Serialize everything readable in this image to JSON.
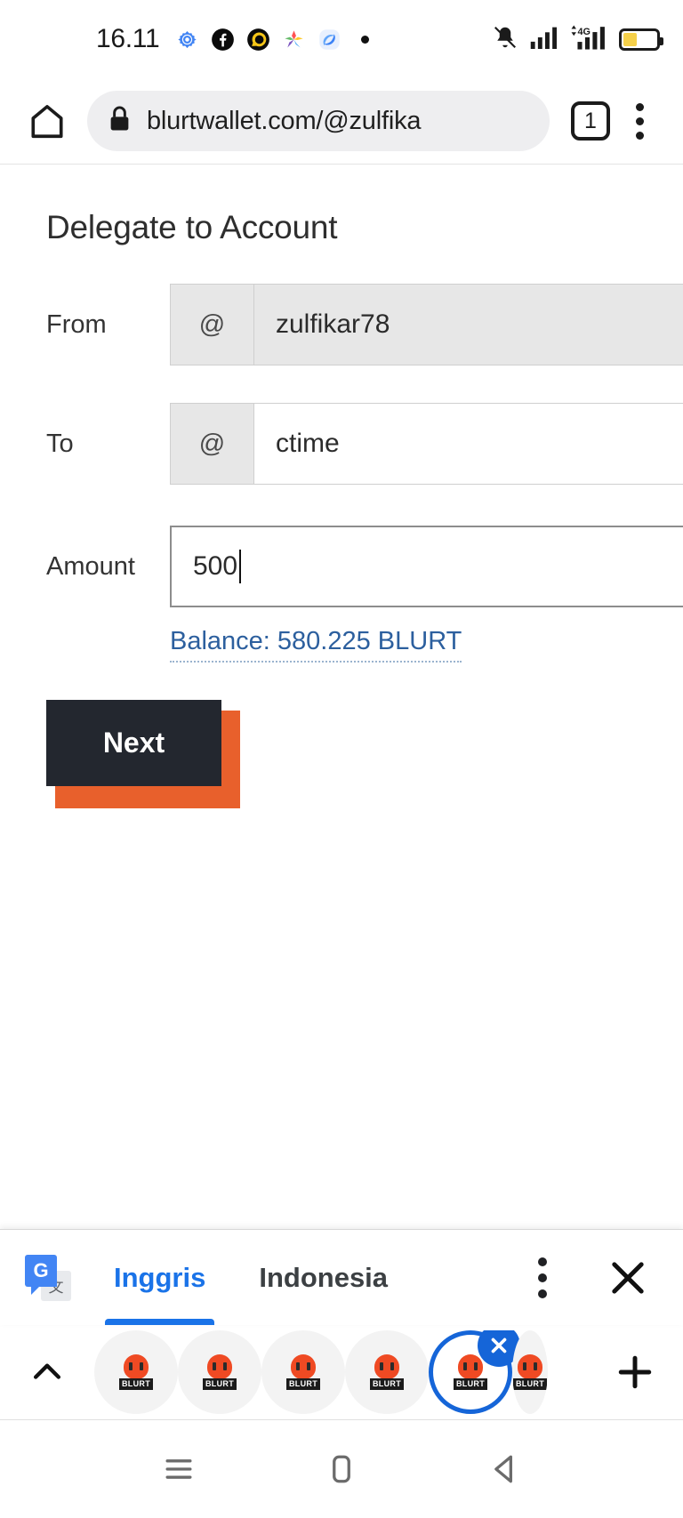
{
  "status_bar": {
    "clock": "16.11",
    "left_icons": [
      "settings-gear-icon",
      "facebook-icon",
      "whatsapp-business-icon",
      "colorful-star-icon",
      "opera-icon",
      "dot-icon"
    ],
    "right_icons": [
      "vibrate-mode-icon",
      "signal-bars-icon",
      "4g-signal-icon",
      "battery-icon"
    ],
    "network_label": "4G"
  },
  "browser": {
    "home_icon": "home-icon",
    "lock_icon": "lock-icon",
    "url": "blurtwallet.com/@zulfika",
    "tab_count": "1",
    "menu_icon": "kebab-menu-icon"
  },
  "page": {
    "title": "Delegate to Account",
    "fields": [
      {
        "label": "From",
        "addon": "@",
        "value": "zulfikar78",
        "state": "readonly"
      },
      {
        "label": "To",
        "addon": "@",
        "value": "ctime",
        "state": "normal"
      },
      {
        "label": "Amount",
        "addon": null,
        "value": "500",
        "state": "focused"
      }
    ],
    "balance_link": "Balance: 580.225 BLURT",
    "next_button": "Next",
    "accent_color": "#e8602c",
    "button_color": "#23272f",
    "link_color": "#2c5f9e"
  },
  "translate_bar": {
    "icon": "google-translate-icon",
    "source_language": "Inggris",
    "target_language": "Indonesia",
    "active_language": "Inggris",
    "menu_icon": "kebab-menu-icon",
    "close_icon": "close-icon",
    "active_color": "#1a73e8"
  },
  "tab_strip": {
    "expand_icon": "chevron-up-icon",
    "tabs": [
      {
        "favicon_label": "BLURT",
        "selected": false
      },
      {
        "favicon_label": "BLURT",
        "selected": false
      },
      {
        "favicon_label": "BLURT",
        "selected": false
      },
      {
        "favicon_label": "BLURT",
        "selected": false
      },
      {
        "favicon_label": "BLURT",
        "selected": true
      },
      {
        "favicon_label": "BLURT",
        "selected": false
      }
    ],
    "close_tab_icon": "close-icon",
    "add_tab_icon": "plus-icon",
    "selected_color": "#1565d8"
  },
  "nav_bar": {
    "buttons": [
      "recents-icon",
      "home-icon",
      "back-icon"
    ]
  }
}
